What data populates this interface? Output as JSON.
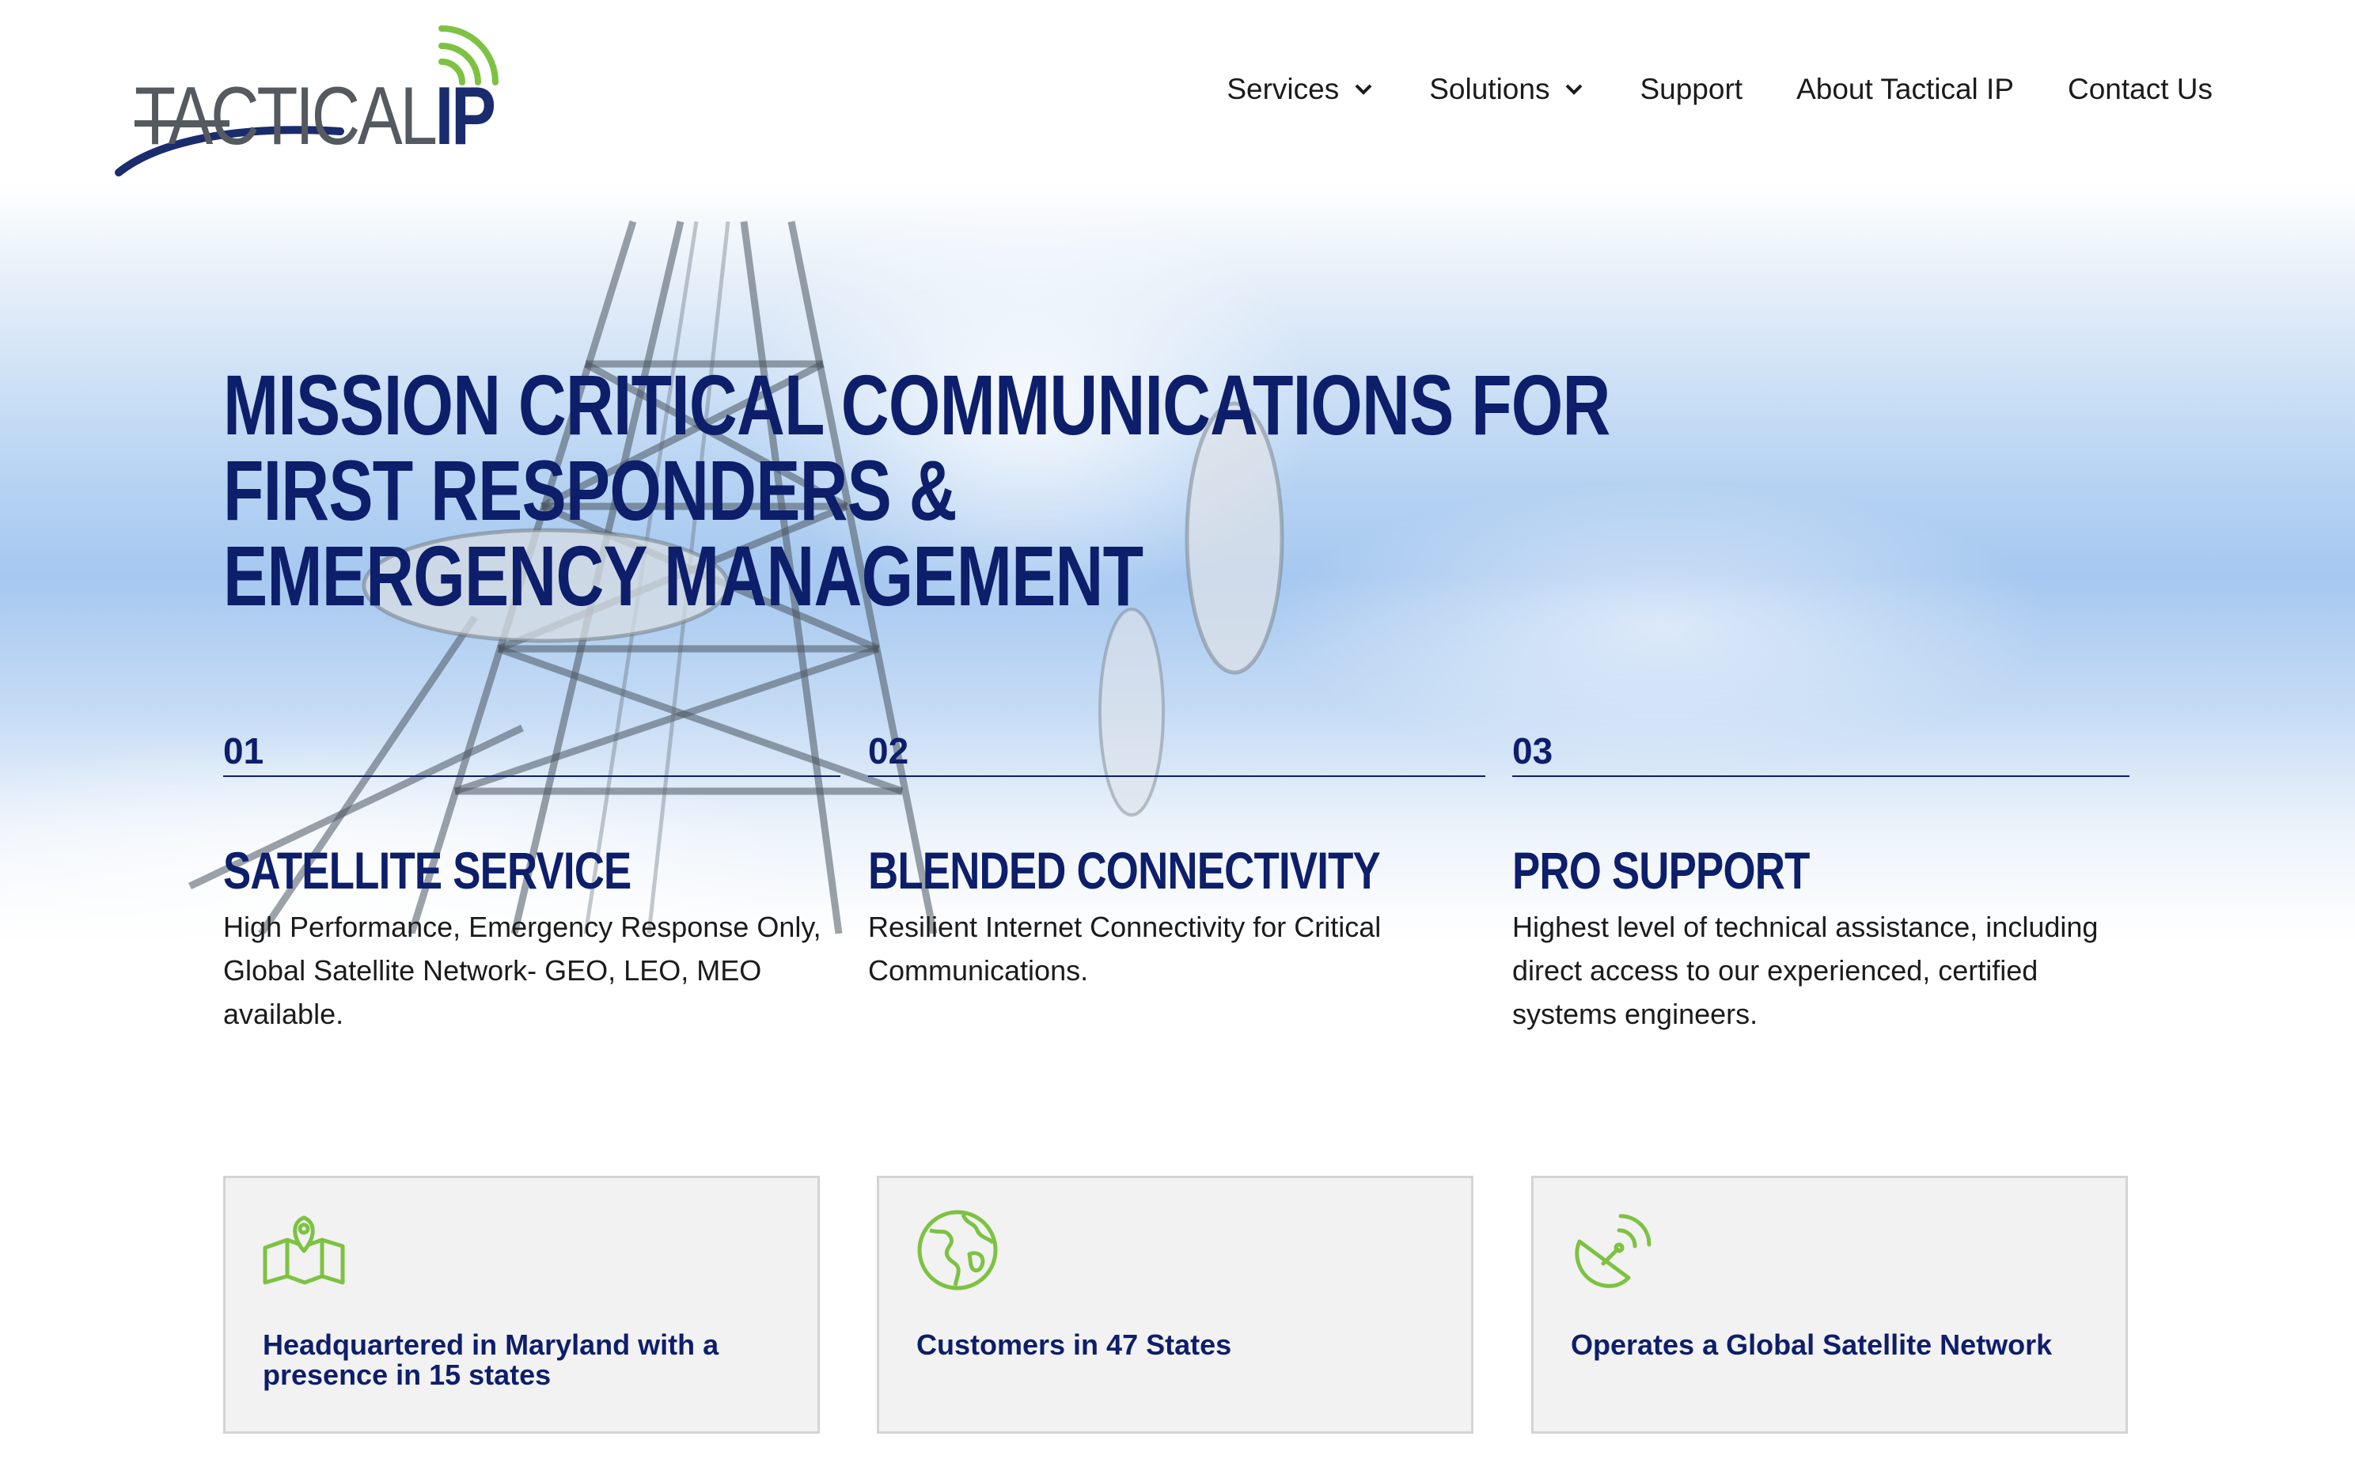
{
  "brand": {
    "logo_text_main": "TACTICAL",
    "logo_text_accent": "IP",
    "colors": {
      "navy": "#0d1e6b",
      "green": "#7dc242",
      "gray": "#555a60"
    }
  },
  "nav": {
    "items": [
      {
        "label": "Services",
        "has_dropdown": true
      },
      {
        "label": "Solutions",
        "has_dropdown": true
      },
      {
        "label": "Support",
        "has_dropdown": false
      },
      {
        "label": "About Tactical IP",
        "has_dropdown": false
      },
      {
        "label": "Contact Us",
        "has_dropdown": false
      }
    ]
  },
  "hero": {
    "headline_line1": "Mission Critical Communications for First Responders &",
    "headline_line2": "Emergency Management"
  },
  "features": [
    {
      "number": "01",
      "title": "Satellite Service",
      "description": "High Performance, Emergency Response Only, Global Satellite Network- GEO, LEO, MEO available."
    },
    {
      "number": "02",
      "title": "Blended Connectivity",
      "description": "Resilient Internet Connectivity for Critical Communications."
    },
    {
      "number": "03",
      "title": "Pro Support",
      "description": "Highest level of technical assistance, including direct access to our experienced, certified systems engineers."
    }
  ],
  "cards": [
    {
      "icon": "map-pin-icon",
      "text": "Headquartered in Maryland with a presence in 15 states"
    },
    {
      "icon": "globe-icon",
      "text": "Customers in 47 States"
    },
    {
      "icon": "satellite-dish-icon",
      "text": "Operates a Global Satellite Network"
    }
  ]
}
